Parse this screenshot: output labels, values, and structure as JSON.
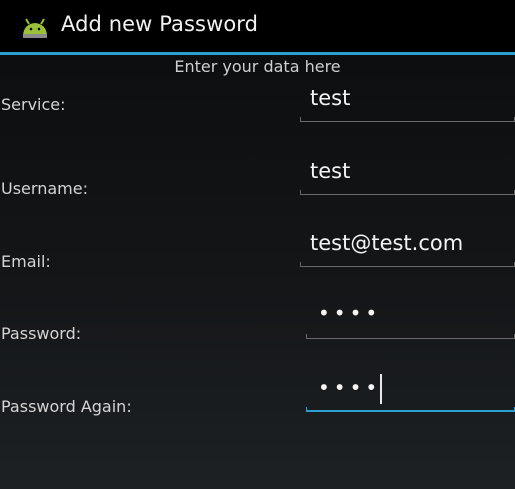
{
  "header": {
    "title": "Add new Password",
    "icon": "android-icon",
    "divider_color": "#2a9fd0"
  },
  "form": {
    "subtitle": "Enter your data here",
    "service": {
      "label": "Service:",
      "value": "test"
    },
    "username": {
      "label": "Username:",
      "value": "test"
    },
    "email": {
      "label": "Email:",
      "value": "test@test.com"
    },
    "password": {
      "label": "Password:",
      "value": "••••"
    },
    "password_again": {
      "label": "Password Again:",
      "value": "••••"
    }
  }
}
